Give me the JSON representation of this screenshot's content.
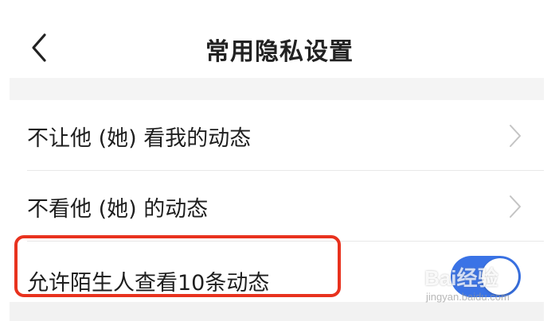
{
  "header": {
    "title": "常用隐私设置",
    "back_icon": "chevron-left-icon"
  },
  "settings": {
    "items": [
      {
        "label": "不让他 (她) 看我的动态",
        "icon": "chevron-right-icon"
      },
      {
        "label": "不看他 (她) 的动态",
        "icon": "chevron-right-icon"
      },
      {
        "label": "允许陌生人查看10条动态",
        "toggle": "on"
      }
    ]
  },
  "watermark": {
    "logo": "Bai经验",
    "sub": "jingyan.baidu.com"
  },
  "colors": {
    "toggle_on": "#3a73e6",
    "highlight": "#e8321e",
    "separator": "#f4f4f4"
  }
}
